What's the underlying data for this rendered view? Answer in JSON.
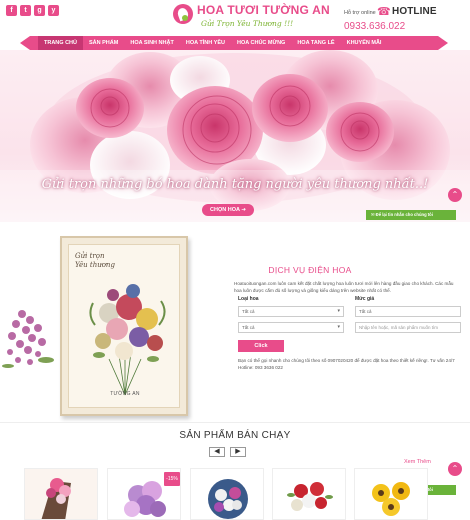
{
  "header": {
    "socials": [
      "f",
      "t",
      "g",
      "y"
    ],
    "logo_title": "HOA TƯƠI TƯỜNG AN",
    "logo_slogan": "Gửi Trọn Yêu Thương !!!",
    "support_label": "Hỗ trợ online",
    "hotline_label": "HOTLINE",
    "hotline_phone": "0933.636.022",
    "icons": [
      "facebook-icon",
      "twitter-icon",
      "google-plus-icon",
      "youtube-icon",
      "phone-icon"
    ]
  },
  "nav": {
    "items": [
      {
        "label": "TRANG CHỦ",
        "active": true
      },
      {
        "label": "SẢN PHẨM",
        "active": false
      },
      {
        "label": "HOA SINH NHẬT",
        "active": false
      },
      {
        "label": "HOA TÌNH YÊU",
        "active": false
      },
      {
        "label": "HOA CHÚC MỪNG",
        "active": false
      },
      {
        "label": "HOA TANG LỄ",
        "active": false
      },
      {
        "label": "KHUYẾN MÃI",
        "active": false
      }
    ]
  },
  "hero": {
    "tagline": "Gửi trọn những bó hoa dành tặng người yêu thương nhất..!",
    "button_label": "CHỌN HOA ➔"
  },
  "floating": {
    "message_tab": "✉ Để lại tin nhắn cho chúng tôi",
    "scroll_top": "⌃"
  },
  "service": {
    "book_script": "Gửi trọn\nYêu thương",
    "book_caption": "TƯỜNG AN",
    "title": "DỊCH VỤ ĐIỆN HOA",
    "description": "Hoatuoituongan.com luôn cam kết đặt chất lượng hoa luôn tươi mới lên hàng đầu giao cho khách. Các mẫu hoa luôn được cắm đủ số lượng và giống kiểu dáng trên website nhất có thể.",
    "type_label": "Loại hoa",
    "price_label": "Mức giá",
    "select_all": "Tất cả",
    "select_all_2": "Tất cả",
    "select_all_3": "Tất cả",
    "keyword_placeholder": "Nhập tên hoặc, mã sản phẩm muốn tìm",
    "click_label": "Click",
    "note": "Bạn có thể gọi nhanh cho chúng tôi theo số 0907020420 để được đặt hoa theo thiết kế riêng!. Tư vấn 24/7 Hotline: 093 3636 022"
  },
  "products": {
    "title": "SẢN PHẨM BÁN CHẠY",
    "prev": "◀",
    "next": "▶",
    "view_more": "Xem Thêm",
    "sale_badge": "-15%"
  }
}
